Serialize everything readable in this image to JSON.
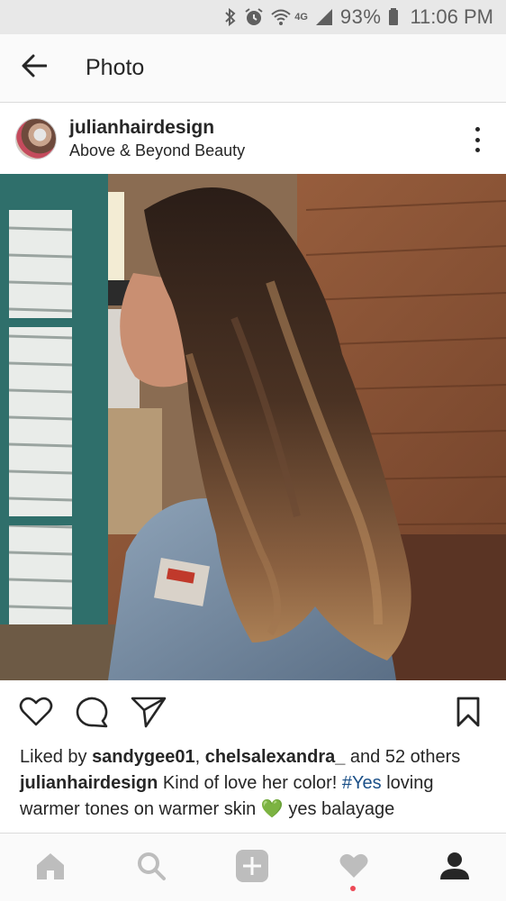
{
  "status_bar": {
    "network": "4G",
    "battery": "93%",
    "time": "11:06 PM",
    "icons": [
      "bluetooth-icon",
      "alarm-icon",
      "wifi-icon",
      "signal-icon",
      "battery-icon"
    ]
  },
  "header": {
    "title": "Photo",
    "back_icon": "arrow-left-icon"
  },
  "post": {
    "username": "julianhairdesign",
    "location": "Above & Beyond Beauty",
    "more_icon": "more-vertical-icon",
    "photo_alt": "photo"
  },
  "actions": {
    "like_icon": "heart-outline-icon",
    "comment_icon": "comment-icon",
    "share_icon": "send-icon",
    "save_icon": "bookmark-icon"
  },
  "likes": {
    "prefix": "Liked by ",
    "user1": "sandygee01",
    "sep": ", ",
    "user2": "chelsalexandra_",
    "suffix": " and 52 others"
  },
  "caption": {
    "username": "julianhairdesign",
    "text1": " Kind of love her color! ",
    "hashtag1": "#Yes",
    "text2": " loving warmer tones on warmer skin ",
    "emoji": "💚",
    "text3": " yes balayage"
  },
  "bottom_nav": {
    "items": [
      "home-icon",
      "search-icon",
      "add-icon",
      "activity-heart-icon",
      "profile-icon"
    ],
    "accent": "#ed4956"
  },
  "colors": {
    "text": "#262626",
    "hashtag": "#1a4f87",
    "status_bar_bg": "#e8e8e8",
    "header_bg": "#fafafa"
  }
}
